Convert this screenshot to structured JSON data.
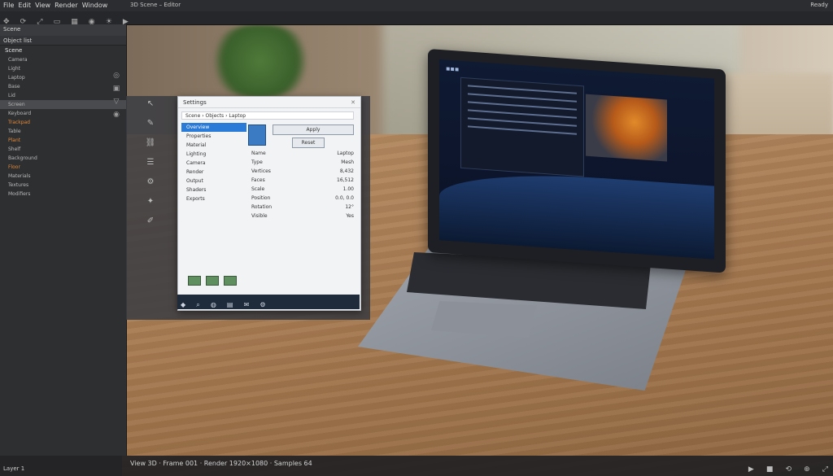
{
  "window": {
    "title": "3D Scene – Editor",
    "right_status": "Ready"
  },
  "menu": {
    "items": [
      "File",
      "Edit",
      "View",
      "Render",
      "Window"
    ]
  },
  "toolbar": {
    "icons": [
      "move-icon",
      "rotate-icon",
      "scale-icon",
      "select-icon",
      "grid-icon",
      "camera-icon",
      "light-icon",
      "render-icon"
    ]
  },
  "left_panel": {
    "header": "Scene",
    "subheader": "Object list",
    "section": "Scene",
    "rows": [
      "Camera",
      "Light",
      "Laptop",
      "Base",
      "Lid",
      "Screen",
      "Keyboard",
      "Trackpad",
      "Table",
      "Plant",
      "Shelf",
      "Background",
      "Floor",
      "Materials",
      "Textures",
      "Modifiers"
    ]
  },
  "dialog": {
    "title": "Settings",
    "path": "Scene › Objects › Laptop",
    "list": [
      "Overview",
      "Properties",
      "Material",
      "Lighting",
      "Camera",
      "Render",
      "Output",
      "Shaders",
      "Exports"
    ],
    "selected": "Overview",
    "details": [
      {
        "k": "Name",
        "v": "Laptop"
      },
      {
        "k": "Type",
        "v": "Mesh"
      },
      {
        "k": "Vertices",
        "v": "8,432"
      },
      {
        "k": "Faces",
        "v": "16,512"
      },
      {
        "k": "Scale",
        "v": "1.00"
      },
      {
        "k": "Position",
        "v": "0.0, 0.0"
      },
      {
        "k": "Rotation",
        "v": "12°"
      },
      {
        "k": "Visible",
        "v": "Yes"
      }
    ],
    "button_primary": "Apply",
    "button_secondary": "Reset"
  },
  "taskbar": {
    "icons": [
      "start-icon",
      "search-icon",
      "browser-icon",
      "files-icon",
      "mail-icon",
      "settings-icon"
    ]
  },
  "bottom": {
    "status": "Layer 1",
    "text": "View 3D · Frame 001 · Render 1920×1080 · Samples 64",
    "icons": [
      "play-icon",
      "stop-icon",
      "loop-icon",
      "zoom-icon",
      "fit-icon"
    ]
  },
  "colors": {
    "accent": "#2a7ad8",
    "orange_accent": "#e0893a"
  }
}
